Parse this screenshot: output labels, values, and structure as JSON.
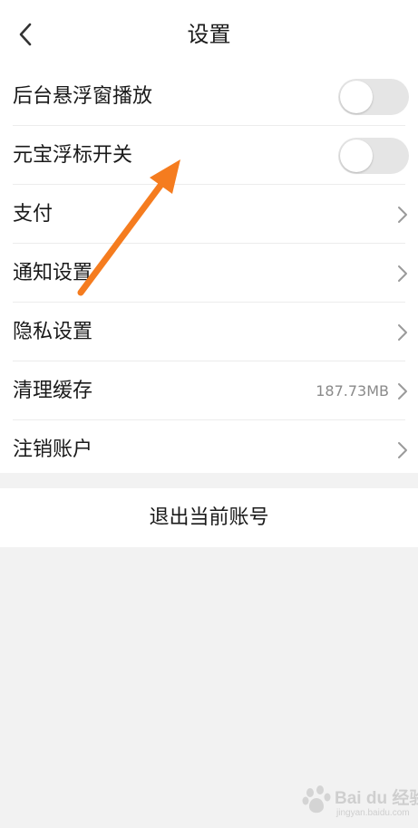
{
  "header": {
    "title": "设置",
    "back_icon": "chevron-left-icon"
  },
  "settings": {
    "rows": [
      {
        "label": "后台悬浮窗播放",
        "control": "toggle",
        "toggle_on": false
      },
      {
        "label": "元宝浮标开关",
        "control": "toggle",
        "toggle_on": false
      },
      {
        "label": "支付",
        "control": "chevron"
      },
      {
        "label": "通知设置",
        "control": "chevron"
      },
      {
        "label": "隐私设置",
        "control": "chevron"
      },
      {
        "label": "清理缓存",
        "control": "chevron",
        "value": "187.73MB"
      },
      {
        "label": "注销账户",
        "control": "chevron"
      }
    ]
  },
  "logout": {
    "label": "退出当前账号"
  },
  "annotation": {
    "arrow_color": "#f57c1f"
  },
  "watermark": {
    "text": "Bai du 经验",
    "sub": "jingyan.baidu.com"
  },
  "colors": {
    "background": "#f2f2f2",
    "toggle_off": "#e5e5e5",
    "accent": "#19c7c1"
  }
}
